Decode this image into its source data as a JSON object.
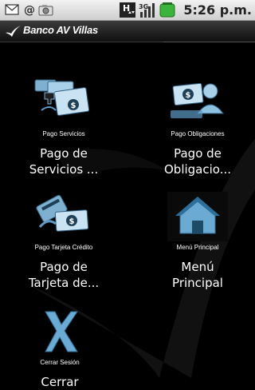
{
  "status_bar": {
    "time": "5:26 p.m.",
    "network_badge": "H",
    "signal_badge": "3G"
  },
  "app": {
    "brand_name": "Banco AV Villas"
  },
  "menu": [
    {
      "icon": "pago-servicios-icon",
      "caption": "Pago Servicios",
      "title_line1": "Pago de",
      "title_line2": "Servicios ..."
    },
    {
      "icon": "pago-obligaciones-icon",
      "caption": "Pago Obligaciones",
      "title_line1": "Pago de",
      "title_line2": "Obligacio..."
    },
    {
      "icon": "pago-tarjeta-credito-icon",
      "caption": "Pago Tarjeta Crédito",
      "title_line1": "Pago de",
      "title_line2": "Tarjeta de..."
    },
    {
      "icon": "menu-principal-icon",
      "caption": "Menú Principal",
      "title_line1": "Menú",
      "title_line2": "Principal"
    },
    {
      "icon": "cerrar-sesion-icon",
      "caption": "Cerrar Sesión",
      "title_line1": "Cerrar",
      "title_line2": ""
    }
  ]
}
